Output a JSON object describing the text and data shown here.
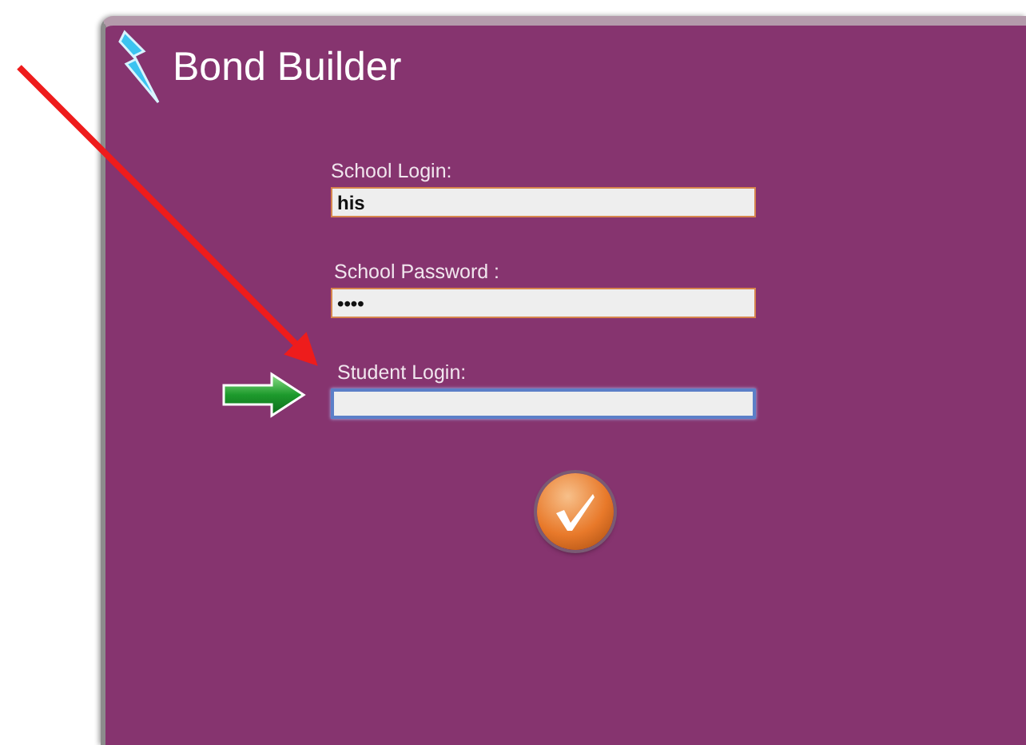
{
  "window": {
    "title": "Bond Builder"
  },
  "fields": [
    {
      "label": "School Login:",
      "value": "his",
      "focused": false,
      "pointer": false
    },
    {
      "label": "School Password :",
      "value": "••••",
      "focused": false,
      "pointer": false
    },
    {
      "label": "Student Login:",
      "focused": true,
      "pointer": true
    }
  ],
  "annotation": {
    "kind": "arrow"
  }
}
